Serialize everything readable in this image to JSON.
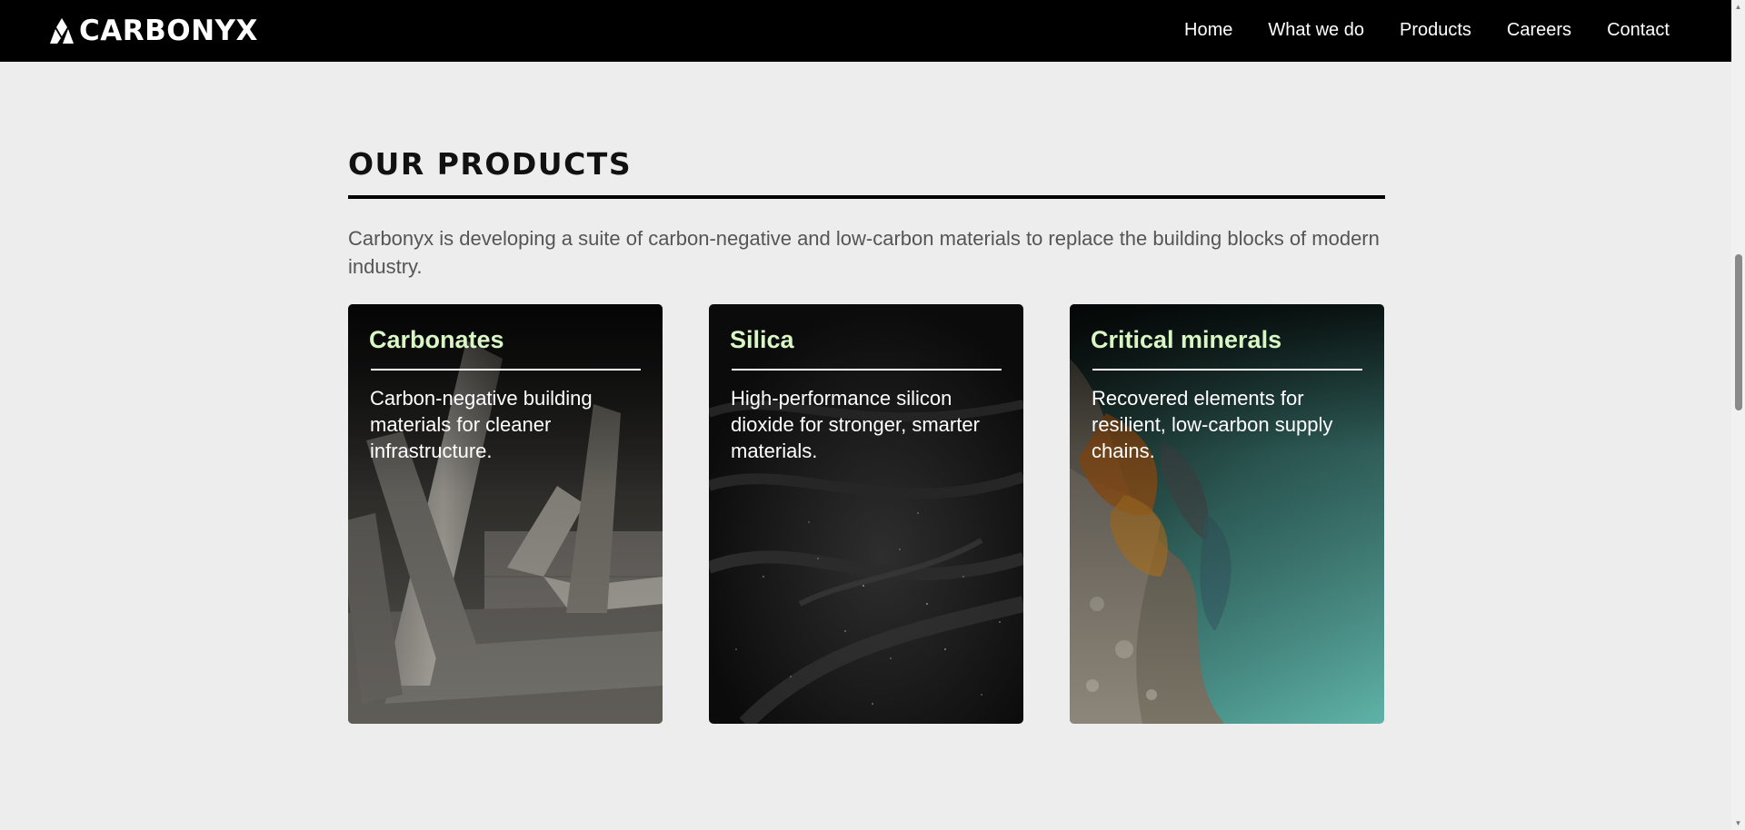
{
  "header": {
    "logo_text": "CARBONYX",
    "nav": [
      "Home",
      "What we do",
      "Products",
      "Careers",
      "Contact"
    ]
  },
  "products": {
    "title": "OUR PRODUCTS",
    "intro": "Carbonyx is developing a suite of carbon-negative and low-carbon materials to replace the building blocks of modern industry.",
    "cards": [
      {
        "title": "Carbonates",
        "description": "Carbon-negative building materials for cleaner infrastructure.",
        "image": "concrete-structure-image"
      },
      {
        "title": "Silica",
        "description": "High-performance silicon dioxide for stronger, smarter materials.",
        "image": "black-sand-image"
      },
      {
        "title": "Critical minerals",
        "description": "Recovered elements for resilient, low-carbon supply chains.",
        "image": "mineral-coast-aerial-image"
      }
    ]
  },
  "colors": {
    "header_bg": "#000000",
    "page_bg": "#ededed",
    "card_title": "#d9f7c5"
  }
}
